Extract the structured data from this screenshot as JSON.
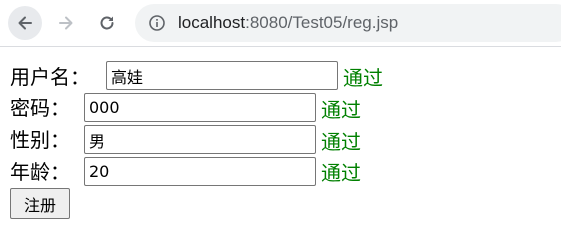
{
  "browser": {
    "url_host": "localhost",
    "url_rest": ":8080/Test05/reg.jsp"
  },
  "form": {
    "username": {
      "label": "用户名：",
      "value": "高娃",
      "status": "通过"
    },
    "password": {
      "label": "密码：",
      "value": "000",
      "status": "通过"
    },
    "gender": {
      "label": "性别：",
      "value": "男",
      "status": "通过"
    },
    "age": {
      "label": "年龄：",
      "value": "20",
      "status": "通过"
    },
    "submit_label": "注册"
  },
  "colors": {
    "status": "#008000"
  }
}
